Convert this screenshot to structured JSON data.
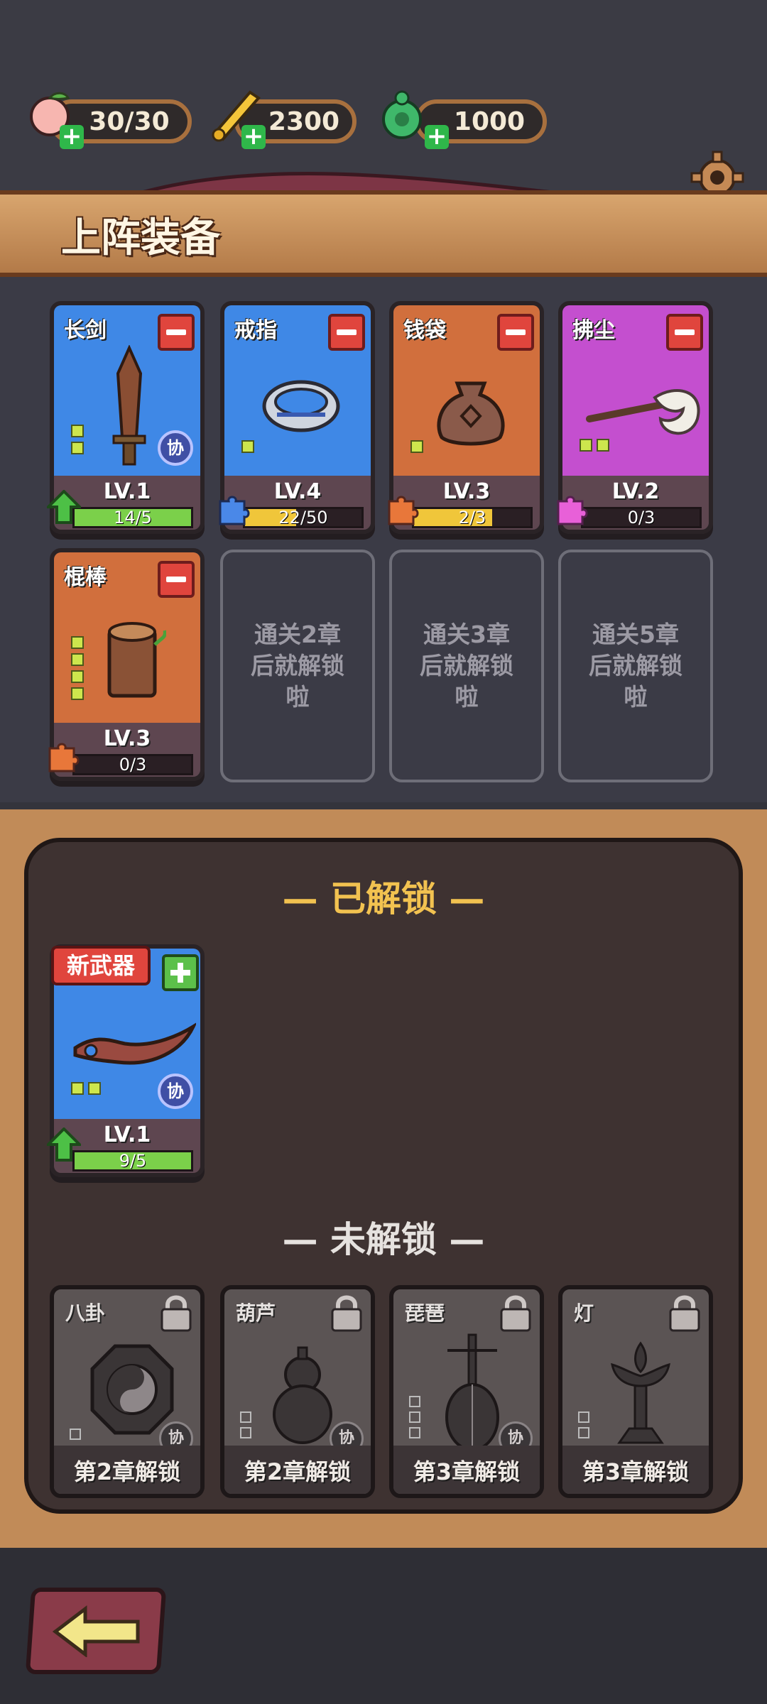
{
  "resources": [
    {
      "icon": "peach-icon",
      "value": "30/30"
    },
    {
      "icon": "golden-scroll-icon",
      "value": "2300"
    },
    {
      "icon": "jade-gourd-icon",
      "value": "1000"
    }
  ],
  "header": {
    "title": "上阵装备"
  },
  "equipped": [
    {
      "name": "长剑",
      "level": "LV.1",
      "progress": "14/5",
      "fill": 1.0,
      "bar_color": "#7bd04a",
      "color": "#3f88e6",
      "pips": 2,
      "synergy": "协",
      "icon": "sword-icon",
      "badge_icon": "upgrade-arrow-icon"
    },
    {
      "name": "戒指",
      "level": "LV.4",
      "progress": "22/50",
      "fill": 0.44,
      "bar_color": "#f0c63a",
      "color": "#3f88e6",
      "pips": 1,
      "synergy": "",
      "icon": "ring-icon",
      "badge_icon": "puzzle-piece-icon"
    },
    {
      "name": "钱袋",
      "level": "LV.3",
      "progress": "2/3",
      "fill": 0.67,
      "bar_color": "#f0c63a",
      "color": "#d16f3d",
      "pips": 1,
      "synergy": "",
      "icon": "money-bag-icon",
      "badge_icon": "puzzle-piece-icon"
    },
    {
      "name": "拂尘",
      "level": "LV.2",
      "progress": "0/3",
      "fill": 0.0,
      "bar_color": "#f0c63a",
      "color": "#c44fcf",
      "pips": 2,
      "synergy": "",
      "icon": "horsetail-whisk-icon",
      "badge_icon": "puzzle-piece-icon"
    },
    {
      "name": "棍棒",
      "level": "LV.3",
      "progress": "0/3",
      "fill": 0.0,
      "bar_color": "#f0c63a",
      "color": "#d16f3d",
      "pips": 4,
      "synergy": "",
      "icon": "club-log-icon",
      "badge_icon": "puzzle-piece-icon"
    }
  ],
  "locked_slots": [
    {
      "text": "通关2章后就解锁啦"
    },
    {
      "text": "通关3章后就解锁啦"
    },
    {
      "text": "通关5章后就解锁啦"
    }
  ],
  "unlocked_section": {
    "title": "— 已解锁 —",
    "items": [
      {
        "tag": "新武器",
        "level": "LV.1",
        "progress": "9/5",
        "fill": 1.0,
        "color": "#3f88e6",
        "pips": 2,
        "synergy": "协",
        "icon": "dagger-icon"
      }
    ]
  },
  "locked_section": {
    "title": "— 未解锁 —",
    "items": [
      {
        "name": "八卦",
        "unlock": "第2章解锁",
        "synergy": "协",
        "pips": 1,
        "icon": "bagua-icon"
      },
      {
        "name": "葫芦",
        "unlock": "第2章解锁",
        "synergy": "协",
        "pips": 2,
        "icon": "gourd-icon"
      },
      {
        "name": "琵琶",
        "unlock": "第3章解锁",
        "synergy": "协",
        "pips": 3,
        "icon": "pipa-icon"
      },
      {
        "name": "灯",
        "unlock": "第3章解锁",
        "synergy": "",
        "pips": 2,
        "icon": "lotus-lamp-icon"
      }
    ]
  },
  "colors": {
    "unlocked_title": "#f2c250",
    "locked_title": "#e6e2df"
  }
}
